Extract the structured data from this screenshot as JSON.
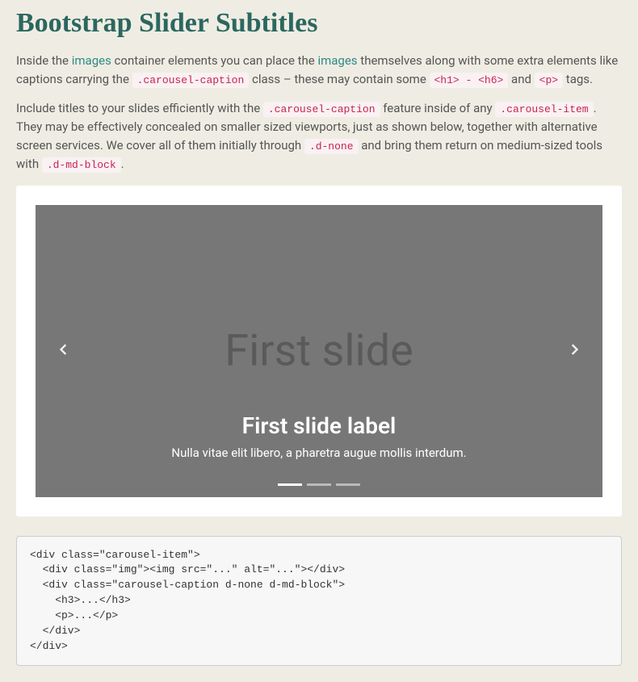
{
  "title": "Bootstrap Slider Subtitles",
  "para1": {
    "t1": "Inside the ",
    "link1": "images",
    "t2": " container elements you can place the ",
    "link2": "images",
    "t3": " themselves along with some extra elements like captions carrying the ",
    "code1": ".carousel-caption",
    "t4": " class – these may contain some ",
    "code2": "<h1> - <h6>",
    "t5": " and ",
    "code3": "<p>",
    "t6": " tags."
  },
  "para2": {
    "t1": "Include titles to your slides efficiently with the ",
    "code1": ".carousel-caption",
    "t2": " feature inside of any ",
    "code2": ".carousel-item",
    "t3": ". They may be effectively concealed on smaller sized viewports, just as shown below, together with alternative screen services. We cover all of them initially through ",
    "code3": ".d-none",
    "t4": " and bring them return on medium-sized tools with ",
    "code4": ".d-md-block",
    "t5": "."
  },
  "carousel": {
    "placeholder": "First slide",
    "caption_title": "First slide label",
    "caption_text": "Nulla vitae elit libero, a pharetra augue mollis interdum.",
    "indicators": 3,
    "active_indicator": 0
  },
  "code": "<div class=\"carousel-item\">\n  <div class=\"img\"><img src=\"...\" alt=\"...\"></div>\n  <div class=\"carousel-caption d-none d-md-block\">\n    <h3>...</h3>\n    <p>...</p>\n  </div>\n</div>"
}
